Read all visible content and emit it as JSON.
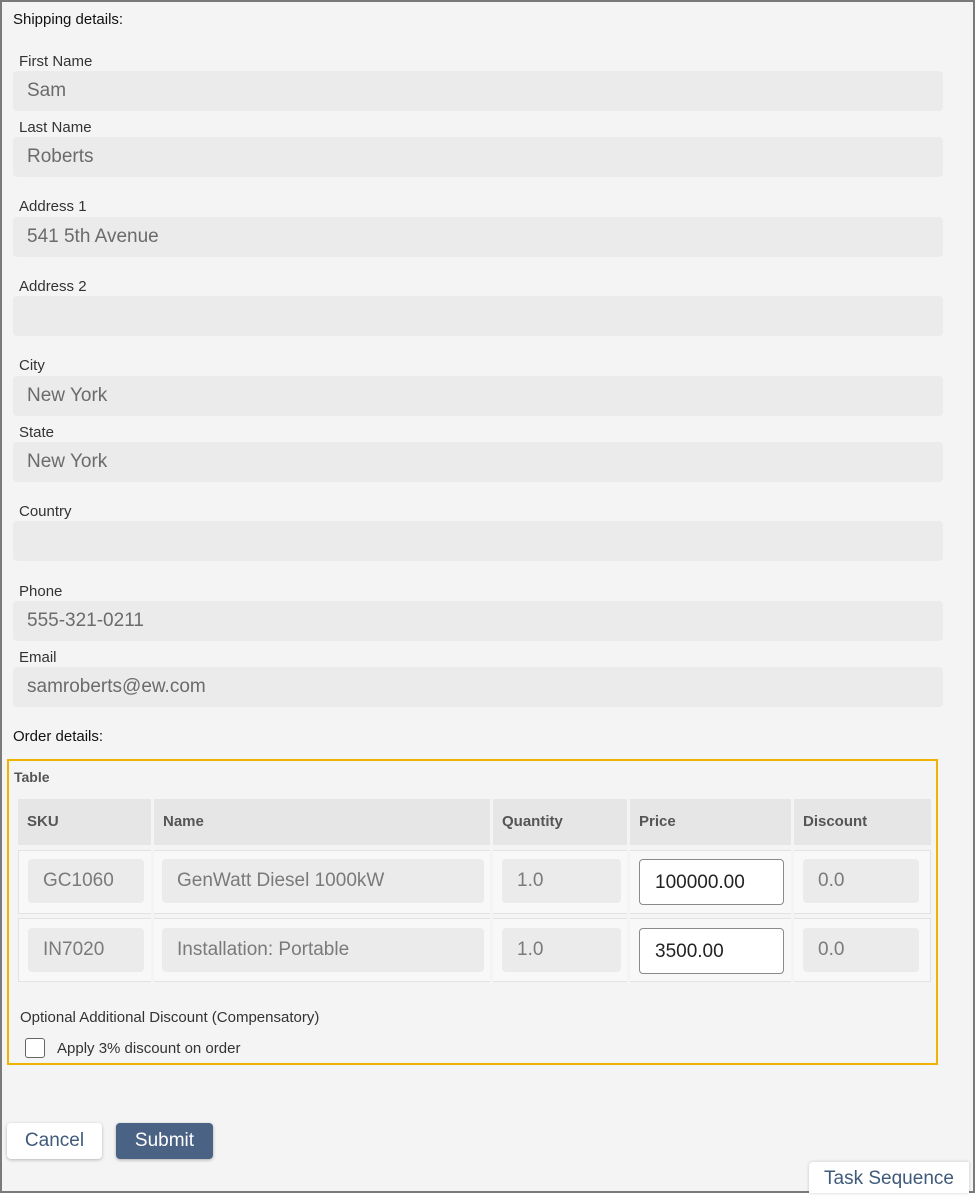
{
  "shipping": {
    "title": "Shipping details:",
    "fields": [
      {
        "label": "First Name",
        "value": "Sam"
      },
      {
        "label": "Last Name",
        "value": "Roberts"
      },
      {
        "label": "Address 1",
        "value": "541 5th Avenue"
      },
      {
        "label": "Address 2",
        "value": ""
      },
      {
        "label": "City",
        "value": "New York"
      },
      {
        "label": "State",
        "value": "New York"
      },
      {
        "label": "Country",
        "value": ""
      },
      {
        "label": "Phone",
        "value": "555-321-0211"
      },
      {
        "label": "Email",
        "value": "samroberts@ew.com"
      }
    ]
  },
  "order": {
    "title": "Order details:",
    "table": {
      "title": "Table",
      "columns": [
        "SKU",
        "Name",
        "Quantity",
        "Price",
        "Discount"
      ],
      "rows": [
        {
          "sku": "GC1060",
          "name": "GenWatt Diesel 1000kW",
          "quantity": "1.0",
          "price": "100000.00",
          "discount": "0.0"
        },
        {
          "sku": "IN7020",
          "name": "Installation: Portable",
          "quantity": "1.0",
          "price": "3500.00",
          "discount": "0.0"
        }
      ]
    },
    "optional_label": "Optional Additional Discount (Compensatory)",
    "checkbox_label": "Apply 3% discount on order",
    "checkbox_checked": false
  },
  "buttons": {
    "cancel": "Cancel",
    "submit": "Submit"
  },
  "task_sequence": "Task Sequence",
  "colors": {
    "highlight_border": "#f0b400",
    "submit_bg": "#4a6284",
    "link_text": "#3f5a7a"
  }
}
